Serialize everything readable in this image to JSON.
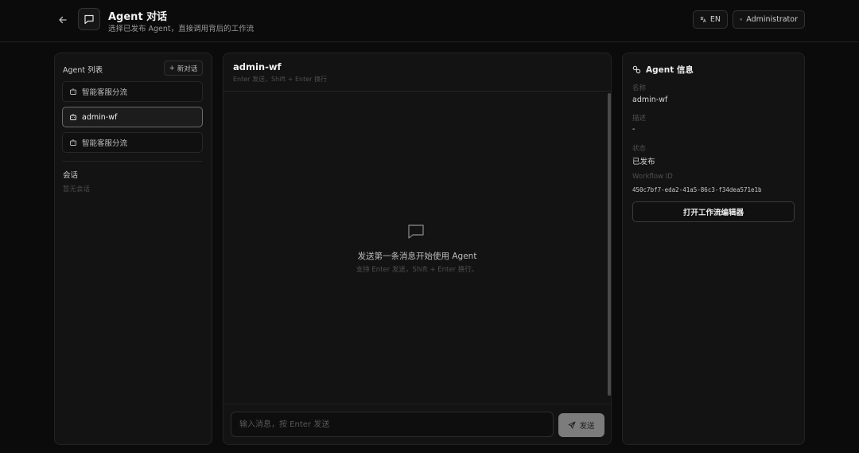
{
  "header": {
    "title": "Agent 对话",
    "subtitle": "选择已发布 Agent，直接调用背后的工作流",
    "lang_label": "EN",
    "user_label": "Administrator"
  },
  "sidebar": {
    "title": "Agent 列表",
    "new_chat_label": "新对话",
    "agents": [
      {
        "label": "智能客服分流",
        "active": false
      },
      {
        "label": "admin-wf",
        "active": true
      },
      {
        "label": "智能客服分流",
        "active": false
      }
    ],
    "conversations_title": "会话",
    "conversations_empty": "暂无会话"
  },
  "chat": {
    "title": "admin-wf",
    "hint": "Enter 发送，Shift + Enter 换行",
    "empty_title": "发送第一条消息开始使用 Agent",
    "empty_sub": "支持 Enter 发送，Shift + Enter 换行。",
    "input_placeholder": "输入消息，按 Enter 发送",
    "send_label": "发送"
  },
  "info": {
    "title": "Agent 信息",
    "name_label": "名称",
    "name_value": "admin-wf",
    "desc_label": "描述",
    "desc_value": "-",
    "status_label": "状态",
    "status_value": "已发布",
    "workflow_label": "Workflow ID",
    "workflow_value": "450c7bf7-eda2-41a5-86c3-f34dea571e1b",
    "open_editor_label": "打开工作流编辑器"
  }
}
